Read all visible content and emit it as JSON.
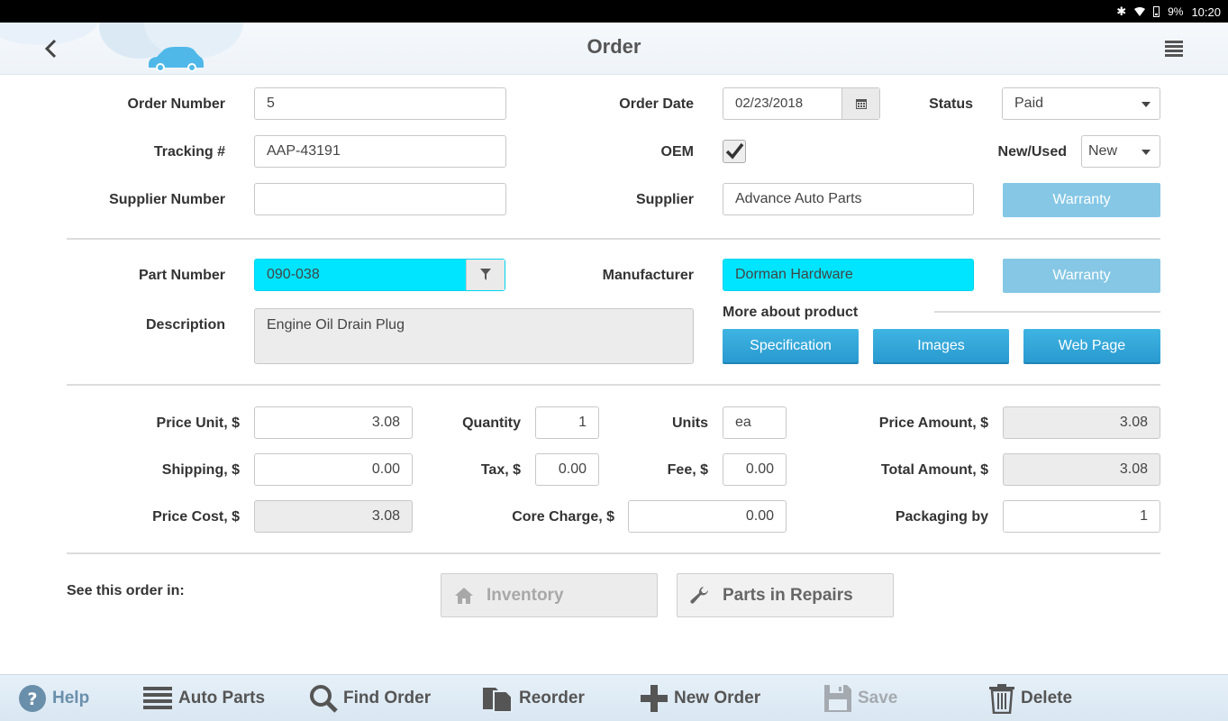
{
  "status_bar": {
    "battery": "9%",
    "time": "10:20"
  },
  "header": {
    "title": "Order"
  },
  "order": {
    "order_number_label": "Order Number",
    "order_number": "5",
    "order_date_label": "Order Date",
    "order_date": "02/23/2018",
    "status_label": "Status",
    "status": "Paid",
    "tracking_label": "Tracking #",
    "tracking": "AAP-43191",
    "oem_label": "OEM",
    "oem_checked": true,
    "new_used_label": "New/Used",
    "new_used": "New",
    "supplier_number_label": "Supplier Number",
    "supplier_number": "",
    "supplier_label": "Supplier",
    "supplier": "Advance Auto Parts",
    "warranty_label": "Warranty"
  },
  "part": {
    "part_number_label": "Part Number",
    "part_number": "090-038",
    "manufacturer_label": "Manufacturer",
    "manufacturer": "Dorman Hardware",
    "warranty_label": "Warranty",
    "description_label": "Description",
    "description": "Engine Oil Drain Plug",
    "more_label": "More about product",
    "spec_label": "Specification",
    "images_label": "Images",
    "web_label": "Web Page"
  },
  "pricing": {
    "price_unit_label": "Price Unit, $",
    "price_unit": "3.08",
    "quantity_label": "Quantity",
    "quantity": "1",
    "units_label": "Units",
    "units": "ea",
    "price_amount_label": "Price Amount, $",
    "price_amount": "3.08",
    "shipping_label": "Shipping, $",
    "shipping": "0.00",
    "tax_label": "Tax, $",
    "tax": "0.00",
    "fee_label": "Fee, $",
    "fee": "0.00",
    "total_amount_label": "Total Amount, $",
    "total_amount": "3.08",
    "price_cost_label": "Price Cost, $",
    "price_cost": "3.08",
    "core_charge_label": "Core Charge, $",
    "core_charge": "0.00",
    "packaging_label": "Packaging by",
    "packaging": "1"
  },
  "see_in": {
    "label": "See this order in:",
    "inventory": "Inventory",
    "repairs": "Parts in Repairs"
  },
  "toolbar": {
    "help": "Help",
    "auto_parts": "Auto Parts",
    "find_order": "Find Order",
    "reorder": "Reorder",
    "new_order": "New Order",
    "save": "Save",
    "delete": "Delete"
  },
  "colors": {
    "highlight": "#00e5ff",
    "accent": "#2a9ad0",
    "light_button": "#85c7e5"
  }
}
